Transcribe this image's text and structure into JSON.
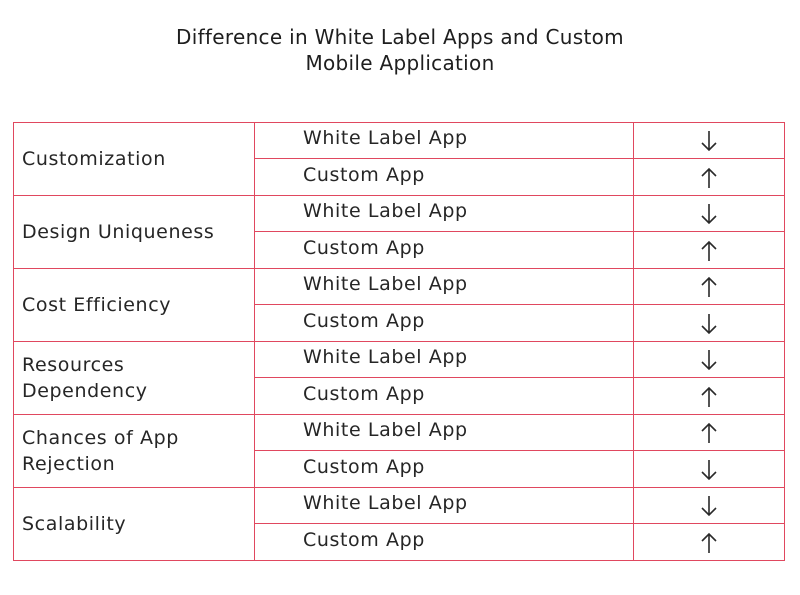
{
  "title": {
    "line1": "Difference in White Label Apps and Custom",
    "line2": "Mobile Application"
  },
  "colors": {
    "border": "#e0485f",
    "text": "#262626"
  },
  "rows": [
    {
      "category": "Customization",
      "items": [
        {
          "app": "White Label App",
          "trend": "down",
          "icon": "arrow-down-icon"
        },
        {
          "app": "Custom App",
          "trend": "up",
          "icon": "arrow-up-icon"
        }
      ]
    },
    {
      "category": "Design Uniqueness",
      "items": [
        {
          "app": "White Label App",
          "trend": "down",
          "icon": "arrow-down-icon"
        },
        {
          "app": "Custom App",
          "trend": "up",
          "icon": "arrow-up-icon"
        }
      ]
    },
    {
      "category": "Cost Efficiency",
      "items": [
        {
          "app": "White Label App",
          "trend": "up",
          "icon": "arrow-up-icon"
        },
        {
          "app": "Custom App",
          "trend": "down",
          "icon": "arrow-down-icon"
        }
      ]
    },
    {
      "category": "Resources Dependency",
      "items": [
        {
          "app": "White Label App",
          "trend": "down",
          "icon": "arrow-down-icon"
        },
        {
          "app": "Custom App",
          "trend": "up",
          "icon": "arrow-up-icon"
        }
      ]
    },
    {
      "category": "Chances of App Rejection",
      "items": [
        {
          "app": "White Label App",
          "trend": "up",
          "icon": "arrow-up-icon"
        },
        {
          "app": "Custom App",
          "trend": "down",
          "icon": "arrow-down-icon"
        }
      ]
    },
    {
      "category": "Scalability",
      "items": [
        {
          "app": "White Label App",
          "trend": "down",
          "icon": "arrow-down-icon"
        },
        {
          "app": "Custom App",
          "trend": "up",
          "icon": "arrow-up-icon"
        }
      ]
    }
  ]
}
